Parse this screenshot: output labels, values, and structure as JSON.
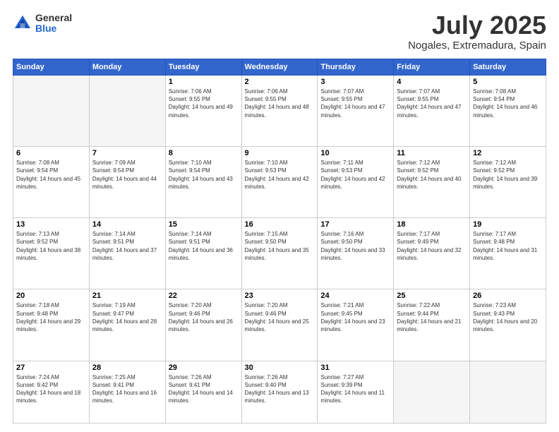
{
  "header": {
    "logo_general": "General",
    "logo_blue": "Blue",
    "title": "July 2025",
    "location": "Nogales, Extremadura, Spain"
  },
  "weekdays": [
    "Sunday",
    "Monday",
    "Tuesday",
    "Wednesday",
    "Thursday",
    "Friday",
    "Saturday"
  ],
  "weeks": [
    [
      {
        "day": "",
        "text": ""
      },
      {
        "day": "",
        "text": ""
      },
      {
        "day": "1",
        "text": "Sunrise: 7:06 AM\nSunset: 9:55 PM\nDaylight: 14 hours and 49 minutes."
      },
      {
        "day": "2",
        "text": "Sunrise: 7:06 AM\nSunset: 9:55 PM\nDaylight: 14 hours and 48 minutes."
      },
      {
        "day": "3",
        "text": "Sunrise: 7:07 AM\nSunset: 9:55 PM\nDaylight: 14 hours and 47 minutes."
      },
      {
        "day": "4",
        "text": "Sunrise: 7:07 AM\nSunset: 9:55 PM\nDaylight: 14 hours and 47 minutes."
      },
      {
        "day": "5",
        "text": "Sunrise: 7:08 AM\nSunset: 9:54 PM\nDaylight: 14 hours and 46 minutes."
      }
    ],
    [
      {
        "day": "6",
        "text": "Sunrise: 7:08 AM\nSunset: 9:54 PM\nDaylight: 14 hours and 45 minutes."
      },
      {
        "day": "7",
        "text": "Sunrise: 7:09 AM\nSunset: 9:54 PM\nDaylight: 14 hours and 44 minutes."
      },
      {
        "day": "8",
        "text": "Sunrise: 7:10 AM\nSunset: 9:54 PM\nDaylight: 14 hours and 43 minutes."
      },
      {
        "day": "9",
        "text": "Sunrise: 7:10 AM\nSunset: 9:53 PM\nDaylight: 14 hours and 42 minutes."
      },
      {
        "day": "10",
        "text": "Sunrise: 7:11 AM\nSunset: 9:53 PM\nDaylight: 14 hours and 42 minutes."
      },
      {
        "day": "11",
        "text": "Sunrise: 7:12 AM\nSunset: 9:52 PM\nDaylight: 14 hours and 40 minutes."
      },
      {
        "day": "12",
        "text": "Sunrise: 7:12 AM\nSunset: 9:52 PM\nDaylight: 14 hours and 39 minutes."
      }
    ],
    [
      {
        "day": "13",
        "text": "Sunrise: 7:13 AM\nSunset: 9:52 PM\nDaylight: 14 hours and 38 minutes."
      },
      {
        "day": "14",
        "text": "Sunrise: 7:14 AM\nSunset: 9:51 PM\nDaylight: 14 hours and 37 minutes."
      },
      {
        "day": "15",
        "text": "Sunrise: 7:14 AM\nSunset: 9:51 PM\nDaylight: 14 hours and 36 minutes."
      },
      {
        "day": "16",
        "text": "Sunrise: 7:15 AM\nSunset: 9:50 PM\nDaylight: 14 hours and 35 minutes."
      },
      {
        "day": "17",
        "text": "Sunrise: 7:16 AM\nSunset: 9:50 PM\nDaylight: 14 hours and 33 minutes."
      },
      {
        "day": "18",
        "text": "Sunrise: 7:17 AM\nSunset: 9:49 PM\nDaylight: 14 hours and 32 minutes."
      },
      {
        "day": "19",
        "text": "Sunrise: 7:17 AM\nSunset: 9:48 PM\nDaylight: 14 hours and 31 minutes."
      }
    ],
    [
      {
        "day": "20",
        "text": "Sunrise: 7:18 AM\nSunset: 9:48 PM\nDaylight: 14 hours and 29 minutes."
      },
      {
        "day": "21",
        "text": "Sunrise: 7:19 AM\nSunset: 9:47 PM\nDaylight: 14 hours and 28 minutes."
      },
      {
        "day": "22",
        "text": "Sunrise: 7:20 AM\nSunset: 9:46 PM\nDaylight: 14 hours and 26 minutes."
      },
      {
        "day": "23",
        "text": "Sunrise: 7:20 AM\nSunset: 9:46 PM\nDaylight: 14 hours and 25 minutes."
      },
      {
        "day": "24",
        "text": "Sunrise: 7:21 AM\nSunset: 9:45 PM\nDaylight: 14 hours and 23 minutes."
      },
      {
        "day": "25",
        "text": "Sunrise: 7:22 AM\nSunset: 9:44 PM\nDaylight: 14 hours and 21 minutes."
      },
      {
        "day": "26",
        "text": "Sunrise: 7:23 AM\nSunset: 9:43 PM\nDaylight: 14 hours and 20 minutes."
      }
    ],
    [
      {
        "day": "27",
        "text": "Sunrise: 7:24 AM\nSunset: 9:42 PM\nDaylight: 14 hours and 18 minutes."
      },
      {
        "day": "28",
        "text": "Sunrise: 7:25 AM\nSunset: 9:41 PM\nDaylight: 14 hours and 16 minutes."
      },
      {
        "day": "29",
        "text": "Sunrise: 7:26 AM\nSunset: 9:41 PM\nDaylight: 14 hours and 14 minutes."
      },
      {
        "day": "30",
        "text": "Sunrise: 7:26 AM\nSunset: 9:40 PM\nDaylight: 14 hours and 13 minutes."
      },
      {
        "day": "31",
        "text": "Sunrise: 7:27 AM\nSunset: 9:39 PM\nDaylight: 14 hours and 11 minutes."
      },
      {
        "day": "",
        "text": ""
      },
      {
        "day": "",
        "text": ""
      }
    ]
  ]
}
